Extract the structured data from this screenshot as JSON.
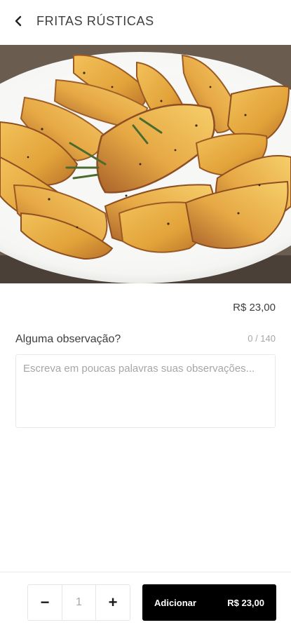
{
  "header": {
    "back_icon": "chevron-left-icon",
    "title": "FRITAS RÚSTICAS"
  },
  "product": {
    "image": "potato-wedges-photo",
    "price": "R$ 23,00"
  },
  "observation": {
    "label": "Alguma observação?",
    "counter": "0 / 140",
    "placeholder": "Escreva em poucas palavras suas observações...",
    "value": ""
  },
  "footer": {
    "minus": "−",
    "quantity": "1",
    "plus": "+",
    "add_label": "Adicionar",
    "add_price": "R$ 23,00"
  },
  "colors": {
    "primary": "#000000",
    "text": "#3e3e3e",
    "muted": "#a6a6a6",
    "border": "#e6e6e6"
  }
}
